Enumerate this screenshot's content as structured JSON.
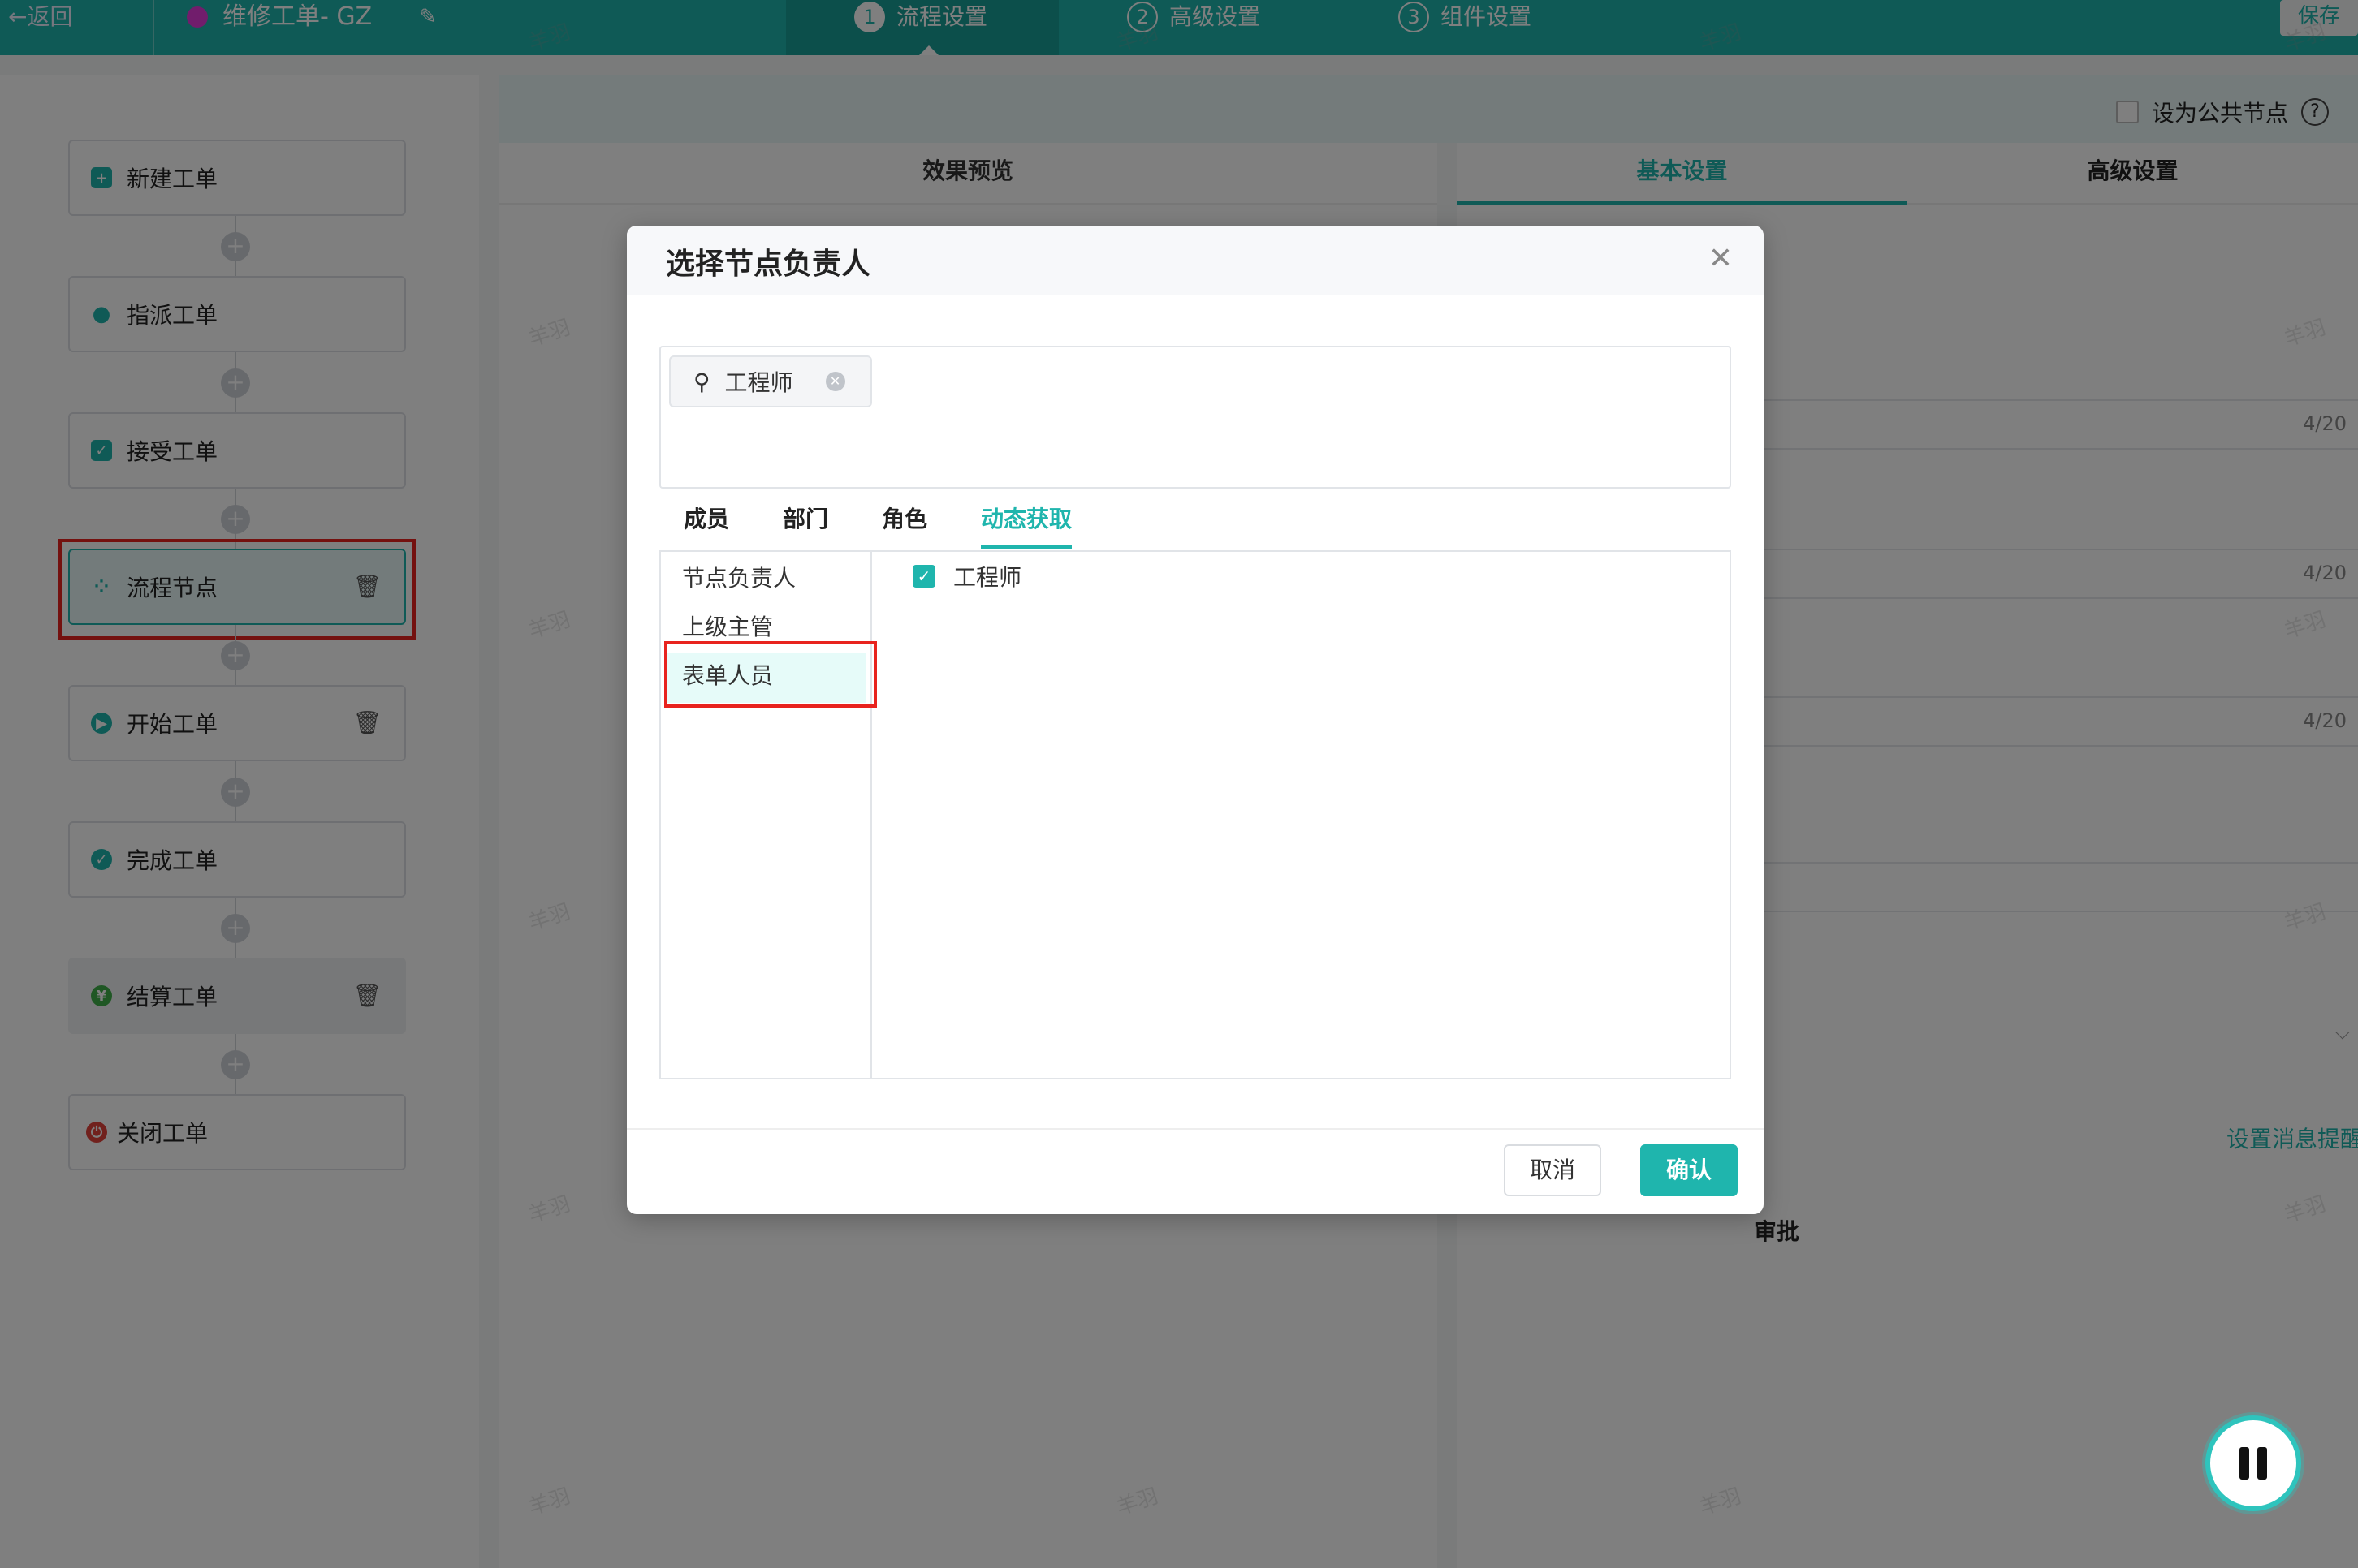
{
  "topbar": {
    "back_label": "←返回",
    "app_title": "维修工单- GZ",
    "steps": [
      {
        "num": "1",
        "label": "流程设置",
        "active": true
      },
      {
        "num": "2",
        "label": "高级设置",
        "active": false
      },
      {
        "num": "3",
        "label": "组件设置",
        "active": false
      }
    ],
    "save_label": "保存"
  },
  "flow": {
    "nodes": [
      {
        "label": "新建工单",
        "icon": "document-add-icon",
        "color": "#1fb5ad"
      },
      {
        "label": "指派工单",
        "icon": "user-icon",
        "color": "#1fb5ad"
      },
      {
        "label": "接受工单",
        "icon": "accept-icon",
        "color": "#1fb5ad"
      },
      {
        "label": "流程节点",
        "icon": "nodes-icon",
        "color": "#1fb5ad",
        "selected": true
      },
      {
        "label": "开始工单",
        "icon": "play-icon",
        "color": "#1fb5ad"
      },
      {
        "label": "完成工单",
        "icon": "check-circle-icon",
        "color": "#1fb5ad"
      },
      {
        "label": "结算工单",
        "icon": "yen-icon",
        "color": "#3fae49"
      },
      {
        "label": "关闭工单",
        "icon": "power-icon",
        "color": "#e2423b"
      }
    ]
  },
  "main": {
    "public_node_label": "设为公共节点",
    "preview_title": "效果预览",
    "settings_tabs": [
      "基本设置",
      "高级设置"
    ],
    "counters": [
      "4/20",
      "4/20",
      "4/20"
    ],
    "message_link": "设置消息提醒",
    "approve_label": "审批"
  },
  "dialog": {
    "title": "选择节点负责人",
    "selected_tag": "工程师",
    "tabs": [
      "成员",
      "部门",
      "角色",
      "动态获取"
    ],
    "left_items": [
      "节点负责人",
      "上级主管",
      "表单人员"
    ],
    "checked_item": "工程师",
    "cancel_label": "取消",
    "ok_label": "确认"
  },
  "watermark": "羊羽"
}
